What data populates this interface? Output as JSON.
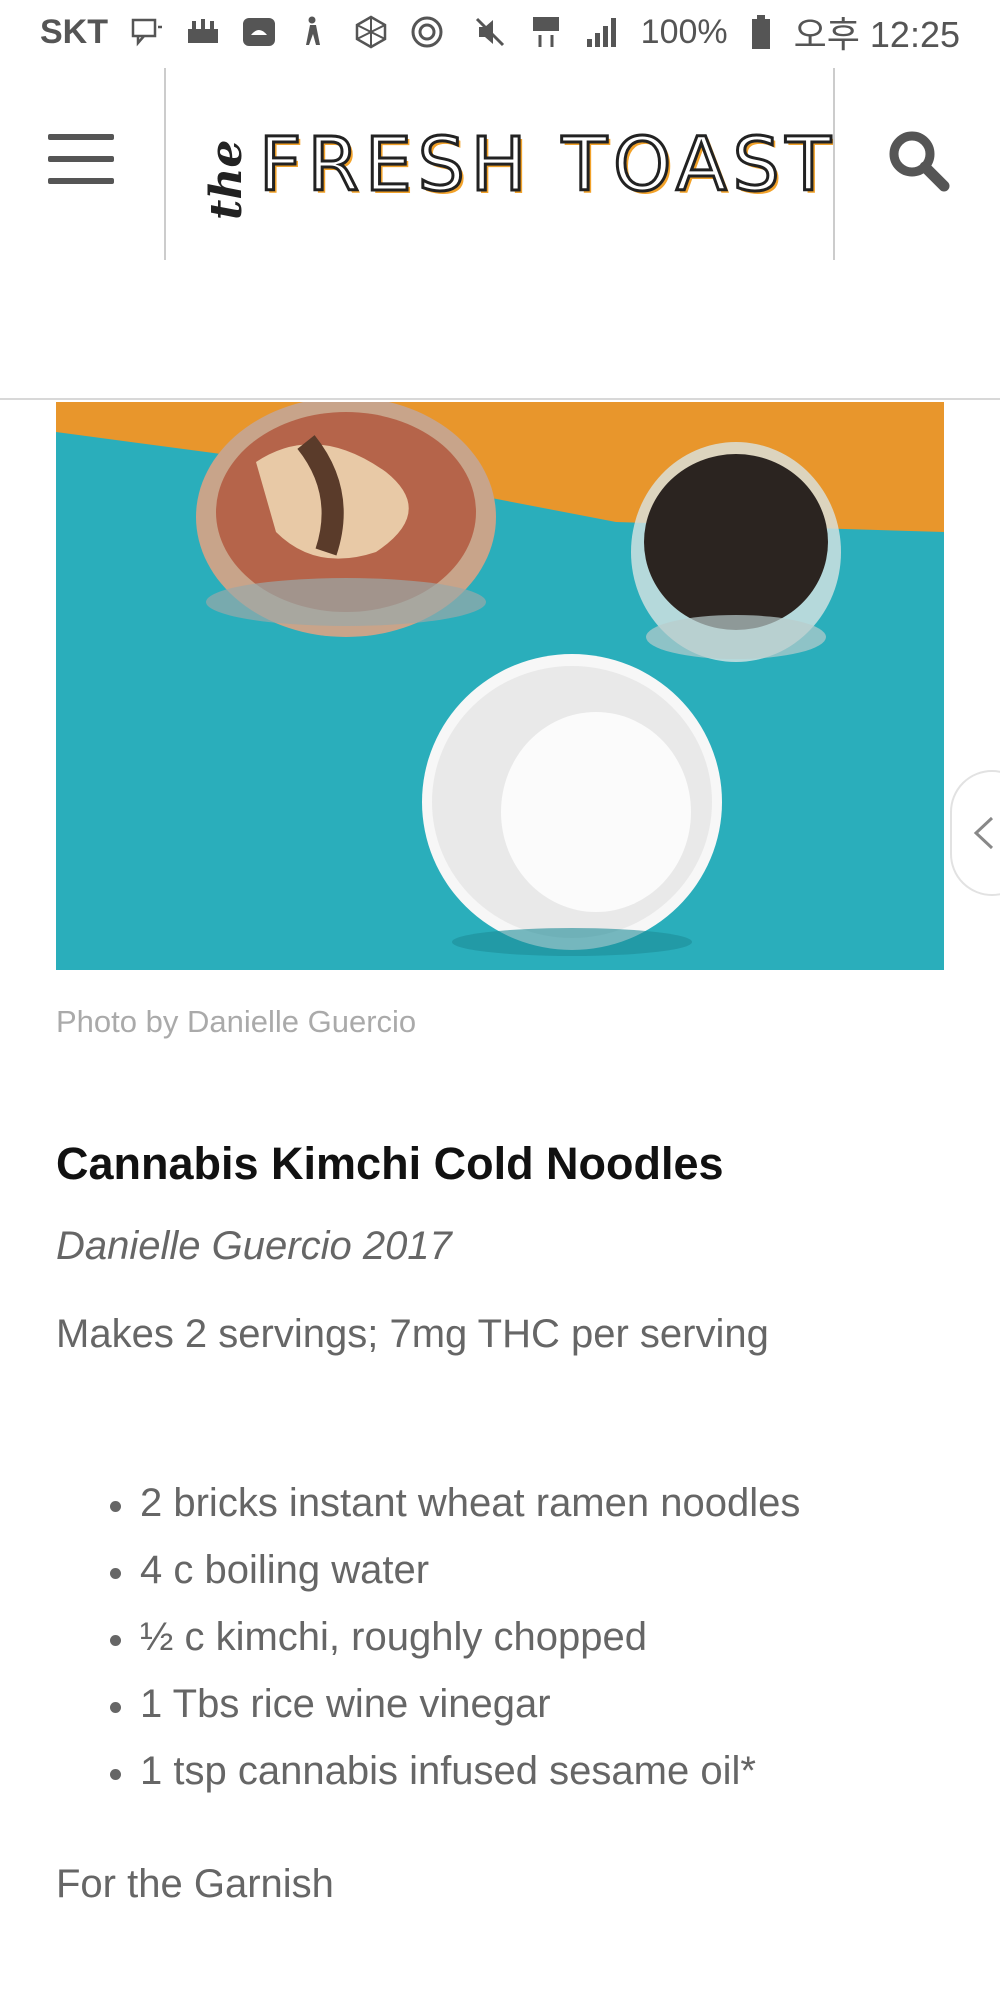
{
  "status_bar": {
    "carrier": "SKT",
    "battery": "100%",
    "am_pm": "오후",
    "time": "12:25",
    "icons": [
      "message-icon",
      "app-icon",
      "android-icon",
      "figure-icon",
      "crypto-icon",
      "swirl-icon",
      "mute-icon",
      "lte-icon",
      "signal-icon",
      "battery-icon"
    ]
  },
  "header": {
    "logo_the": "the",
    "logo_main": "FRESH TOAST",
    "menu_icon": "hamburger-menu-icon",
    "search_icon": "search-icon",
    "logo_accent": "#f2a22a"
  },
  "article": {
    "photo_caption": "Photo by Danielle Guercio",
    "title": "Cannabis Kimchi Cold Noodles",
    "byline": "Danielle Guercio 2017",
    "servings": "Makes 2 servings; 7mg THC per serving",
    "ingredients": [
      "2 bricks instant wheat ramen noodles",
      "4 c boiling water",
      "½ c kimchi, roughly chopped",
      "1 Tbs rice wine vinegar",
      "1 tsp cannabis infused sesame oil*"
    ],
    "garnish_heading": "For the Garnish"
  },
  "colors": {
    "photo_teal": "#2aaebb",
    "photo_orange": "#e8962c"
  }
}
